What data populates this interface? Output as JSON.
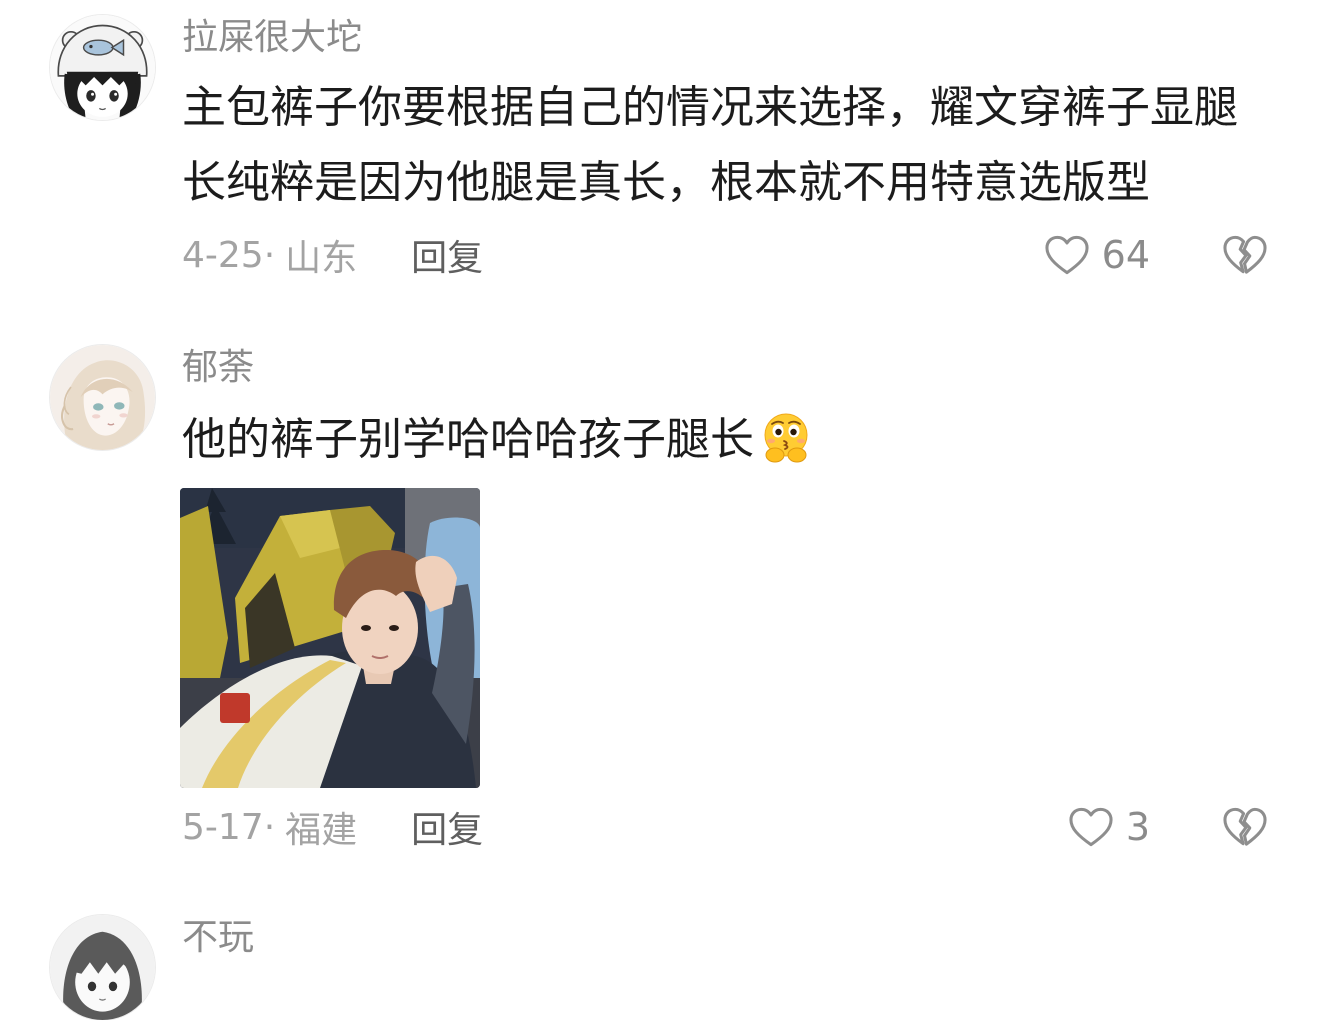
{
  "colors": {
    "text": "#1c1c1c",
    "username": "#8b8b8b",
    "meta": "#a3a3a3",
    "reply": "#5f5f5f",
    "count": "#8b8b8b",
    "icon": "#8e8e8e",
    "background": "#ffffff"
  },
  "icons": {
    "like": "heart-outline-icon",
    "dislike": "broken-heart-icon"
  },
  "comments": [
    {
      "username": "拉屎很大坨",
      "text_lines": [
        "主包裤子你要根据自己的情况来选择，耀文穿裤子显腿",
        "长纯粹是因为他腿是真长，根本就不用特意选版型"
      ],
      "date": "4-25",
      "separator": "·",
      "location": "山东",
      "reply_label": "回复",
      "likes": "64"
    },
    {
      "username": "郁荼",
      "text_lines": [
        "他的裤子别学哈哈哈孩子腿长"
      ],
      "emoji": "thinking-face-emoji",
      "date": "5-17",
      "separator": "·",
      "location": "福建",
      "reply_label": "回复",
      "likes": "3"
    },
    {
      "username": "不玩"
    }
  ]
}
